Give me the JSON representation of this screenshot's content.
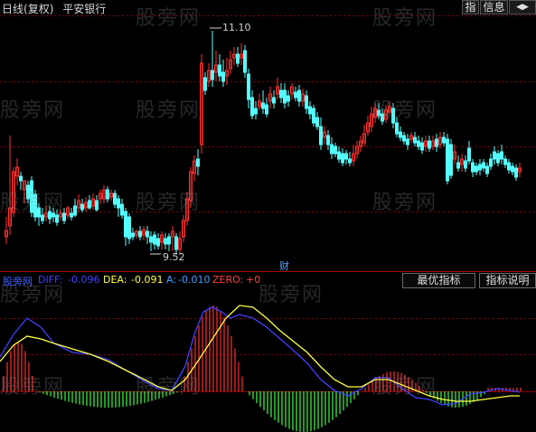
{
  "header": {
    "period": "日线",
    "adjust": "(复权)",
    "stock_name": "平安银行",
    "btn_index": "指",
    "btn_info": "信息",
    "btn_back": "◀▶"
  },
  "watermark": "股旁网",
  "price_panel": {
    "high_label": "11.10",
    "low_label": "9.52",
    "cai_label": "财",
    "colors": {
      "up": "#ff3030",
      "down": "#54ffff",
      "grid": "#8b0000"
    }
  },
  "indicator_bar": {
    "name": "股旁网",
    "diff_label": "DIFF:",
    "diff_value": "-0.096",
    "dea_label": "DEA:",
    "dea_value": "-0.091",
    "a_label": "A:",
    "a_value": "-0.010",
    "zero_label": "ZERO:",
    "zero_value": "+0",
    "btn_best": "最优指标",
    "btn_help": "指标说明",
    "colors": {
      "diff": "#4040ff",
      "dea": "#ffff40",
      "a": "#40a0ff",
      "zero": "#ff4040",
      "hist_pos": "#ff3030",
      "hist_neg": "#40ff40"
    }
  }
}
